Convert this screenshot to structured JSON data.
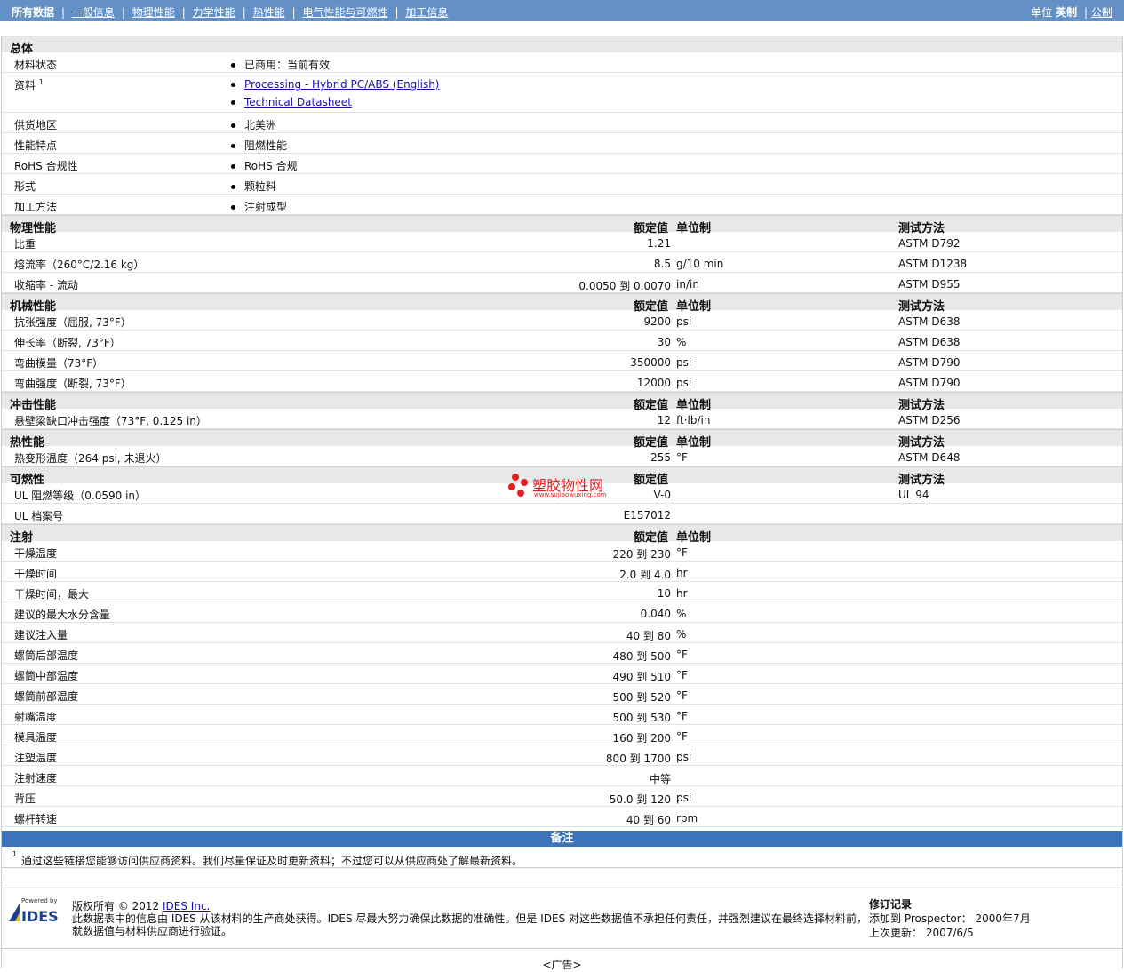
{
  "nav": {
    "active": "所有数据",
    "links": [
      "一般信息",
      "物理性能",
      "力学性能",
      "热性能",
      "电气性能与可燃性",
      "加工信息"
    ]
  },
  "units": {
    "label": "单位",
    "active": "英制",
    "other": "公制"
  },
  "general": {
    "title": "总体",
    "rows": [
      {
        "label": "材料状态",
        "values": [
          "已商用：当前有效"
        ]
      },
      {
        "label": "资料",
        "sup": "1",
        "links": [
          "Processing - Hybrid PC/ABS (English)",
          "Technical Datasheet"
        ]
      },
      {
        "label": "供货地区",
        "values": [
          "北美洲"
        ]
      },
      {
        "label": "性能特点",
        "values": [
          "阻燃性能"
        ]
      },
      {
        "label": "RoHS 合规性",
        "values": [
          "RoHS 合规"
        ]
      },
      {
        "label": "形式",
        "values": [
          "颗粒料"
        ]
      },
      {
        "label": "加工方法",
        "values": [
          "注射成型"
        ]
      }
    ]
  },
  "columns": {
    "value": "额定值",
    "unit": "单位制",
    "test": "测试方法"
  },
  "sections": [
    {
      "title": "物理性能",
      "show_unit": true,
      "show_test": true,
      "rows": [
        {
          "label": "比重",
          "value": "1.21",
          "unit": "",
          "test": "ASTM D792"
        },
        {
          "label": "熔流率（260°C/2.16 kg）",
          "value": "8.5",
          "unit": "g/10 min",
          "test": "ASTM D1238"
        },
        {
          "label": "收缩率 - 流动",
          "value": "0.0050 到  0.0070",
          "unit": "in/in",
          "test": "ASTM D955"
        }
      ]
    },
    {
      "title": "机械性能",
      "show_unit": true,
      "show_test": true,
      "rows": [
        {
          "label": "抗张强度（屈服, 73°F）",
          "value": "9200",
          "unit": "psi",
          "test": "ASTM D638"
        },
        {
          "label": "伸长率（断裂, 73°F）",
          "value": "30",
          "unit": "%",
          "test": "ASTM D638"
        },
        {
          "label": "弯曲模量（73°F）",
          "value": "350000",
          "unit": "psi",
          "test": "ASTM D790"
        },
        {
          "label": "弯曲强度（断裂, 73°F）",
          "value": "12000",
          "unit": "psi",
          "test": "ASTM D790"
        }
      ]
    },
    {
      "title": "冲击性能",
      "show_unit": true,
      "show_test": true,
      "rows": [
        {
          "label": "悬壁梁缺口冲击强度（73°F, 0.125 in）",
          "value": "12",
          "unit": "ft·lb/in",
          "test": "ASTM D256"
        }
      ]
    },
    {
      "title": "热性能",
      "show_unit": true,
      "show_test": true,
      "rows": [
        {
          "label": "热变形温度（264 psi, 未退火）",
          "value": "255",
          "unit": "°F",
          "test": "ASTM D648"
        }
      ]
    },
    {
      "title": "可燃性",
      "show_unit": false,
      "show_test": true,
      "rows": [
        {
          "label": "UL 阻燃等级（0.0590 in）",
          "value": "V-0",
          "unit": "",
          "test": "UL 94"
        },
        {
          "label": "UL 档案号",
          "value": "E157012",
          "unit": "",
          "test": ""
        }
      ]
    },
    {
      "title": "注射",
      "show_unit": true,
      "show_test": false,
      "rows": [
        {
          "label": "干燥温度",
          "value": "220 到  230",
          "unit": "°F",
          "test": ""
        },
        {
          "label": "干燥时间",
          "value": "2.0 到  4.0",
          "unit": "hr",
          "test": ""
        },
        {
          "label": "干燥时间，最大",
          "value": "10",
          "unit": "hr",
          "test": ""
        },
        {
          "label": "建议的最大水分含量",
          "value": "0.040",
          "unit": "%",
          "test": ""
        },
        {
          "label": "建议注入量",
          "value": "40 到  80",
          "unit": "%",
          "test": ""
        },
        {
          "label": "螺筒后部温度",
          "value": "480 到  500",
          "unit": "°F",
          "test": ""
        },
        {
          "label": "螺筒中部温度",
          "value": "490 到  510",
          "unit": "°F",
          "test": ""
        },
        {
          "label": "螺筒前部温度",
          "value": "500 到  520",
          "unit": "°F",
          "test": ""
        },
        {
          "label": "射嘴温度",
          "value": "500 到  530",
          "unit": "°F",
          "test": ""
        },
        {
          "label": "模具温度",
          "value": "160 到  200",
          "unit": "°F",
          "test": ""
        },
        {
          "label": "注塑温度",
          "value": "800 到  1700",
          "unit": "psi",
          "test": ""
        },
        {
          "label": "注射速度",
          "value": "中等",
          "unit": "",
          "test": ""
        },
        {
          "label": "背压",
          "value": "50.0 到  120",
          "unit": "psi",
          "test": ""
        },
        {
          "label": "螺杆转速",
          "value": "40 到  60",
          "unit": "rpm",
          "test": ""
        }
      ]
    }
  ],
  "notes": {
    "title": "备注",
    "footnote_num": "1",
    "footnote": "通过这些链接您能够访问供应商资料。我们尽量保证及时更新资料；不过您可以从供应商处了解最新资料。"
  },
  "footer": {
    "powered_by": "Powered by",
    "logo_text": "IDES",
    "copyright": "版权所有 © 2012",
    "copyright_link": "IDES Inc.",
    "disclaimer_line1": "此数据表中的信息由 IDES 从该材料的生产商处获得。IDES 尽最大努力确保此数据的准确性。但是 IDES 对这些数据值不承担任何责任，并强烈建议在最终选择材料前，",
    "disclaimer_line2": "就数据值与材料供应商进行验证。",
    "revision_title": "修订记录",
    "added_label": "添加到 Prospector：",
    "added_value": "2000年7月",
    "updated_label": "上次更新：",
    "updated_value": "2007/6/5"
  },
  "watermark": {
    "cn": "塑胶物性网",
    "url": "www.sujiaowuxing.com"
  },
  "ad": "<广告>"
}
